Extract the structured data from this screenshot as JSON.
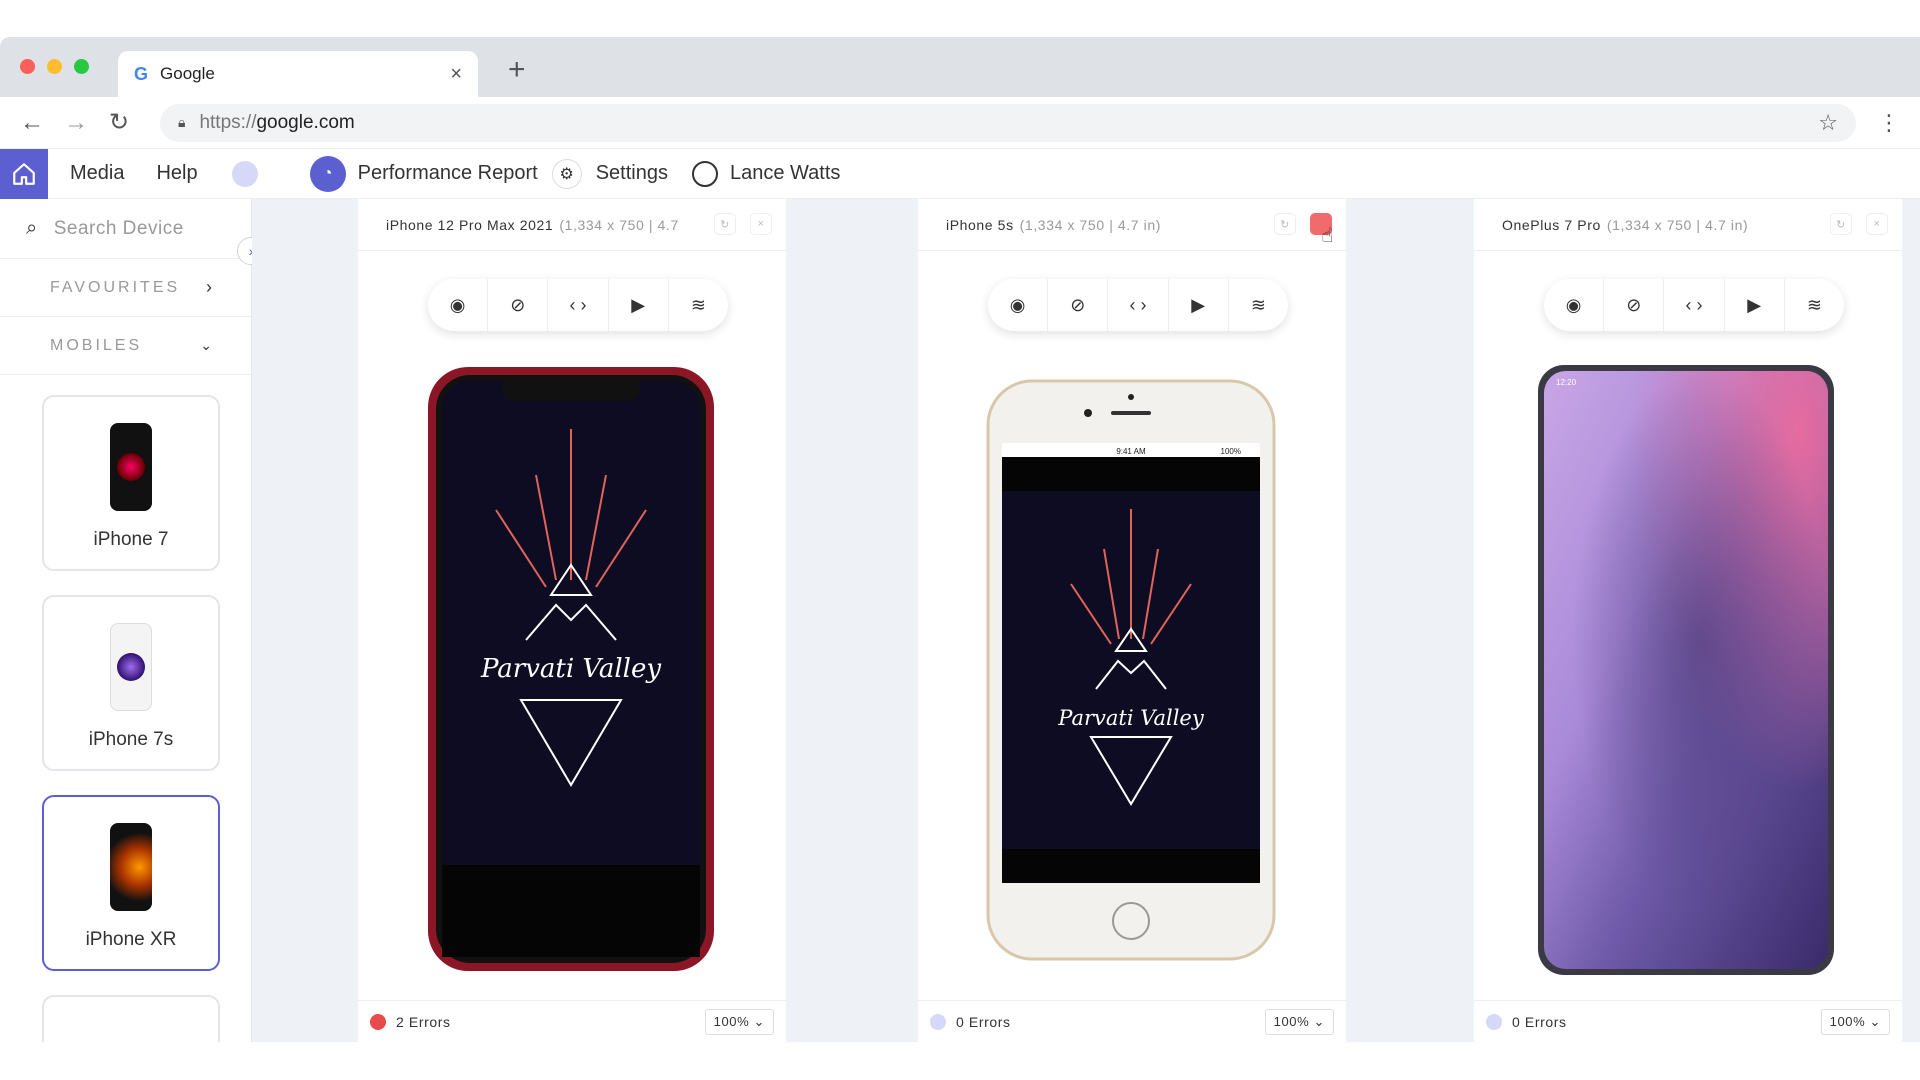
{
  "browser": {
    "tab_title": "Google",
    "tab_icon": "G",
    "url_scheme": "https://",
    "url_host": "google.com"
  },
  "app": {
    "menu": [
      "Media",
      "Help"
    ],
    "performance_report": "Performance Report",
    "settings": "Settings",
    "user_name": "Lance Watts",
    "accent": "#5b5fcf"
  },
  "sidebar": {
    "search_placeholder": "Search Device",
    "favourites": "FAVOURITES",
    "mobiles": "MOBILES",
    "devices": [
      {
        "name": "iPhone 7"
      },
      {
        "name": "iPhone 7s"
      },
      {
        "name": "iPhone XR"
      }
    ]
  },
  "panels": [
    {
      "model": "iPhone 12 Pro Max 2021",
      "spec": "(1,334 x 750  | 4.7",
      "errors": "2 Errors",
      "error_color": "#e84b4b",
      "zoom": "100%"
    },
    {
      "model": "iPhone 5s",
      "spec": "(1,334 x 750  | 4.7 in)",
      "errors": "0 Errors",
      "error_color": "#d5d8f7",
      "zoom": "100%"
    },
    {
      "model": "OnePlus 7 Pro",
      "spec": "(1,334 x 750  | 4.7 in)",
      "errors": "0 Errors",
      "error_color": "#d5d8f7",
      "zoom": "100%"
    }
  ],
  "wallpaper_text": "Parvati Valley",
  "status_time": "9:41 AM",
  "status_battery": "100%",
  "oneplus_time": "12:20"
}
